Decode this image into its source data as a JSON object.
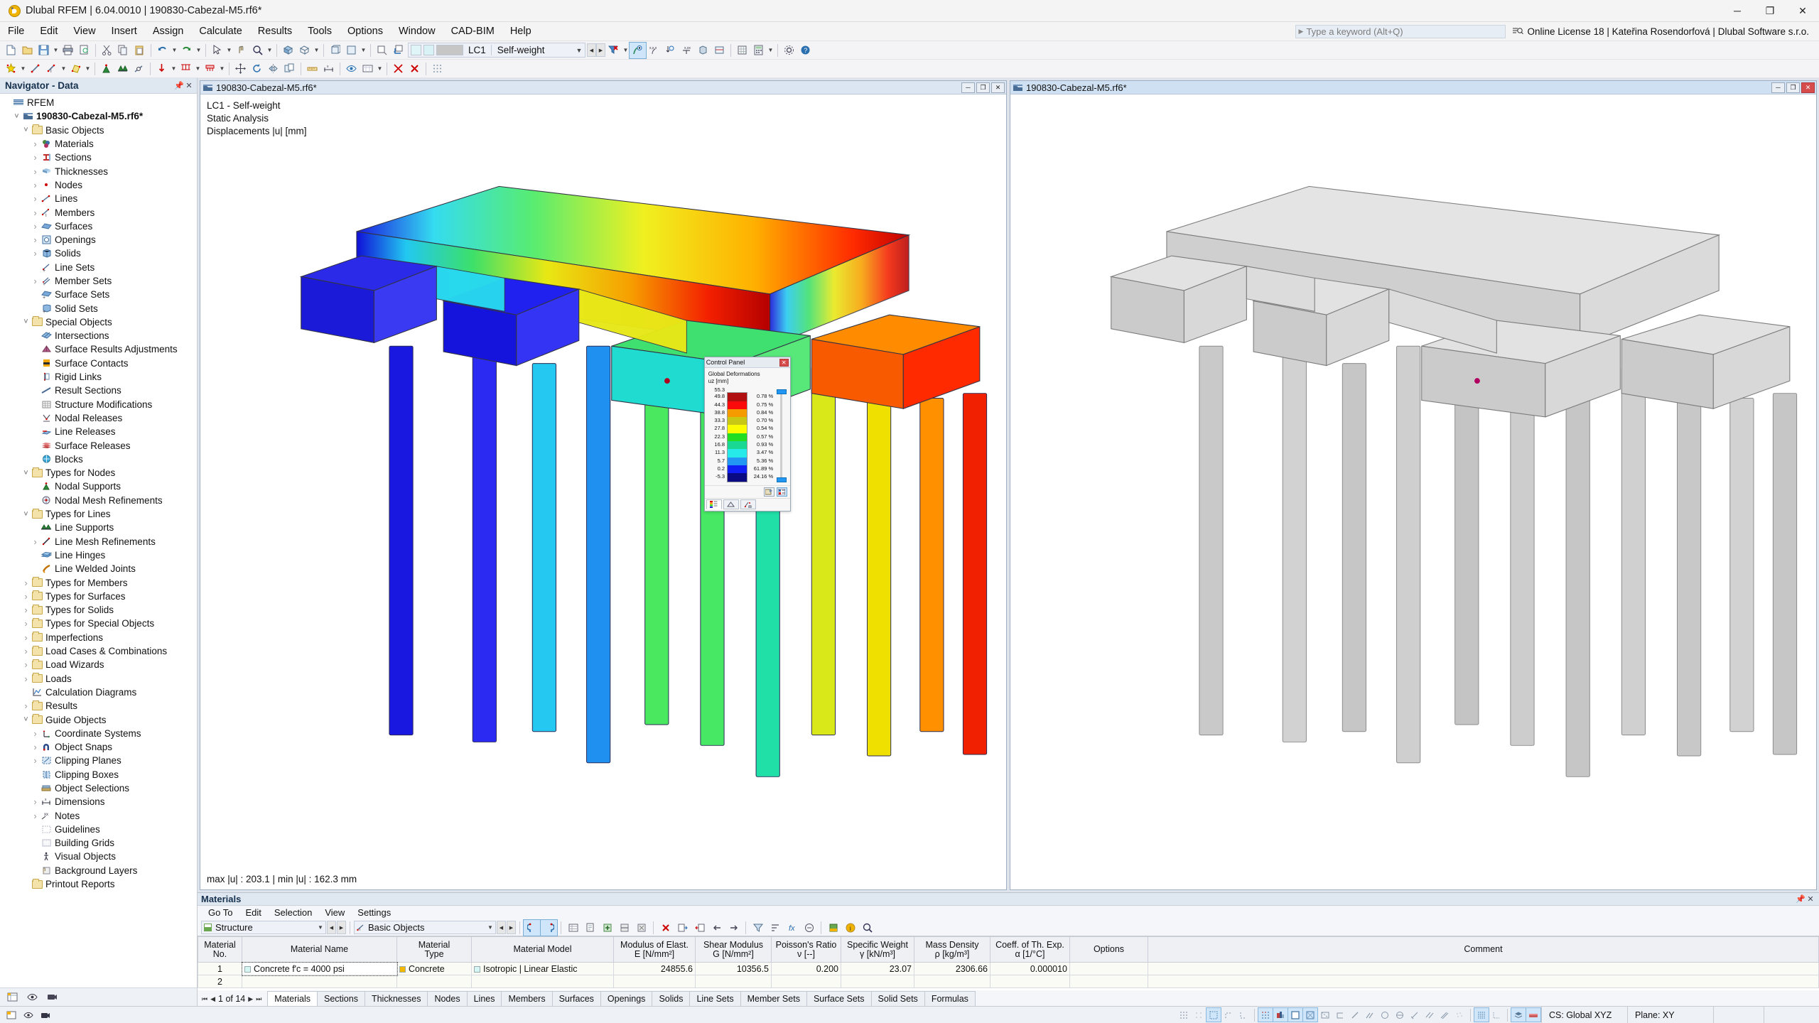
{
  "window": {
    "title": "Dlubal RFEM | 6.04.0010 | 190830-Cabezal-M5.rf6*",
    "app_icon": "dlubal-logo-icon",
    "minimize": "─",
    "maximize": "❐",
    "close": "✕"
  },
  "menubar": {
    "items": [
      {
        "label": "File"
      },
      {
        "label": "Edit"
      },
      {
        "label": "View"
      },
      {
        "label": "Insert"
      },
      {
        "label": "Assign"
      },
      {
        "label": "Calculate"
      },
      {
        "label": "Results"
      },
      {
        "label": "Tools"
      },
      {
        "label": "Options"
      },
      {
        "label": "Window"
      },
      {
        "label": "CAD-BIM"
      },
      {
        "label": "Help"
      }
    ],
    "keyword_placeholder": "Type a keyword (Alt+Q)",
    "license": "Online License 18 | Kateřina Rosendorfová | Dlubal Software s.r.o."
  },
  "toolbar": {
    "load_case_id": "LC1",
    "load_case_name": "Self-weight"
  },
  "navigator": {
    "title": "Navigator - Data",
    "root": "RFEM",
    "model": "190830-Cabezal-M5.rf6*",
    "items": [
      {
        "label": "RFEM",
        "indent": 0,
        "icon": "rfem-icon",
        "twisty": "",
        "bold": false
      },
      {
        "label": "190830-Cabezal-M5.rf6*",
        "indent": 1,
        "icon": "model-icon",
        "twisty": "open",
        "bold": true
      },
      {
        "label": "Basic Objects",
        "indent": 2,
        "icon": "folder",
        "twisty": "open",
        "bold": false
      },
      {
        "label": "Materials",
        "indent": 3,
        "icon": "materials-icon",
        "twisty": "closed"
      },
      {
        "label": "Sections",
        "indent": 3,
        "icon": "sections-icon",
        "twisty": "closed"
      },
      {
        "label": "Thicknesses",
        "indent": 3,
        "icon": "thicknesses-icon",
        "twisty": "closed"
      },
      {
        "label": "Nodes",
        "indent": 3,
        "icon": "nodes-icon",
        "twisty": "closed"
      },
      {
        "label": "Lines",
        "indent": 3,
        "icon": "lines-icon",
        "twisty": "closed"
      },
      {
        "label": "Members",
        "indent": 3,
        "icon": "members-icon",
        "twisty": "closed"
      },
      {
        "label": "Surfaces",
        "indent": 3,
        "icon": "surfaces-icon",
        "twisty": "closed"
      },
      {
        "label": "Openings",
        "indent": 3,
        "icon": "openings-icon",
        "twisty": "closed"
      },
      {
        "label": "Solids",
        "indent": 3,
        "icon": "solids-icon",
        "twisty": "closed"
      },
      {
        "label": "Line Sets",
        "indent": 3,
        "icon": "line-sets-icon",
        "twisty": ""
      },
      {
        "label": "Member Sets",
        "indent": 3,
        "icon": "member-sets-icon",
        "twisty": "closed"
      },
      {
        "label": "Surface Sets",
        "indent": 3,
        "icon": "surface-sets-icon",
        "twisty": ""
      },
      {
        "label": "Solid Sets",
        "indent": 3,
        "icon": "solid-sets-icon",
        "twisty": ""
      },
      {
        "label": "Special Objects",
        "indent": 2,
        "icon": "folder",
        "twisty": "open"
      },
      {
        "label": "Intersections",
        "indent": 3,
        "icon": "intersections-icon",
        "twisty": ""
      },
      {
        "label": "Surface Results Adjustments",
        "indent": 3,
        "icon": "surface-results-adjustments-icon",
        "twisty": ""
      },
      {
        "label": "Surface Contacts",
        "indent": 3,
        "icon": "surface-contacts-icon",
        "twisty": ""
      },
      {
        "label": "Rigid Links",
        "indent": 3,
        "icon": "rigid-links-icon",
        "twisty": ""
      },
      {
        "label": "Result Sections",
        "indent": 3,
        "icon": "result-sections-icon",
        "twisty": ""
      },
      {
        "label": "Structure Modifications",
        "indent": 3,
        "icon": "structure-modifications-icon",
        "twisty": ""
      },
      {
        "label": "Nodal Releases",
        "indent": 3,
        "icon": "nodal-releases-icon",
        "twisty": ""
      },
      {
        "label": "Line Releases",
        "indent": 3,
        "icon": "line-releases-icon",
        "twisty": ""
      },
      {
        "label": "Surface Releases",
        "indent": 3,
        "icon": "surface-releases-icon",
        "twisty": ""
      },
      {
        "label": "Blocks",
        "indent": 3,
        "icon": "blocks-icon",
        "twisty": ""
      },
      {
        "label": "Types for Nodes",
        "indent": 2,
        "icon": "folder",
        "twisty": "open"
      },
      {
        "label": "Nodal Supports",
        "indent": 3,
        "icon": "nodal-supports-icon",
        "twisty": ""
      },
      {
        "label": "Nodal Mesh Refinements",
        "indent": 3,
        "icon": "nodal-mesh-refinements-icon",
        "twisty": ""
      },
      {
        "label": "Types for Lines",
        "indent": 2,
        "icon": "folder",
        "twisty": "open"
      },
      {
        "label": "Line Supports",
        "indent": 3,
        "icon": "line-supports-icon",
        "twisty": ""
      },
      {
        "label": "Line Mesh Refinements",
        "indent": 3,
        "icon": "line-mesh-refinements-icon",
        "twisty": "closed"
      },
      {
        "label": "Line Hinges",
        "indent": 3,
        "icon": "line-hinges-icon",
        "twisty": ""
      },
      {
        "label": "Line Welded Joints",
        "indent": 3,
        "icon": "line-welded-joints-icon",
        "twisty": ""
      },
      {
        "label": "Types for Members",
        "indent": 2,
        "icon": "folder",
        "twisty": "closed"
      },
      {
        "label": "Types for Surfaces",
        "indent": 2,
        "icon": "folder",
        "twisty": "closed"
      },
      {
        "label": "Types for Solids",
        "indent": 2,
        "icon": "folder",
        "twisty": "closed"
      },
      {
        "label": "Types for Special Objects",
        "indent": 2,
        "icon": "folder",
        "twisty": "closed"
      },
      {
        "label": "Imperfections",
        "indent": 2,
        "icon": "folder",
        "twisty": "closed"
      },
      {
        "label": "Load Cases & Combinations",
        "indent": 2,
        "icon": "folder",
        "twisty": "closed"
      },
      {
        "label": "Load Wizards",
        "indent": 2,
        "icon": "folder",
        "twisty": "closed"
      },
      {
        "label": "Loads",
        "indent": 2,
        "icon": "folder",
        "twisty": "closed"
      },
      {
        "label": "Calculation Diagrams",
        "indent": 2,
        "icon": "calculation-diagrams-icon",
        "twisty": ""
      },
      {
        "label": "Results",
        "indent": 2,
        "icon": "folder",
        "twisty": "closed"
      },
      {
        "label": "Guide Objects",
        "indent": 2,
        "icon": "folder",
        "twisty": "open"
      },
      {
        "label": "Coordinate Systems",
        "indent": 3,
        "icon": "coordinate-systems-icon",
        "twisty": "closed"
      },
      {
        "label": "Object Snaps",
        "indent": 3,
        "icon": "object-snaps-icon",
        "twisty": "closed"
      },
      {
        "label": "Clipping Planes",
        "indent": 3,
        "icon": "clipping-planes-icon",
        "twisty": "closed"
      },
      {
        "label": "Clipping Boxes",
        "indent": 3,
        "icon": "clipping-boxes-icon",
        "twisty": ""
      },
      {
        "label": "Object Selections",
        "indent": 3,
        "icon": "object-selections-icon",
        "twisty": ""
      },
      {
        "label": "Dimensions",
        "indent": 3,
        "icon": "dimensions-icon",
        "twisty": "closed"
      },
      {
        "label": "Notes",
        "indent": 3,
        "icon": "notes-icon",
        "twisty": "closed"
      },
      {
        "label": "Guidelines",
        "indent": 3,
        "icon": "guidelines-icon",
        "twisty": ""
      },
      {
        "label": "Building Grids",
        "indent": 3,
        "icon": "building-grids-icon",
        "twisty": ""
      },
      {
        "label": "Visual Objects",
        "indent": 3,
        "icon": "visual-objects-icon",
        "twisty": ""
      },
      {
        "label": "Background Layers",
        "indent": 3,
        "icon": "background-layers-icon",
        "twisty": ""
      },
      {
        "label": "Printout Reports",
        "indent": 2,
        "icon": "folder",
        "twisty": ""
      }
    ]
  },
  "viewport_left": {
    "title": "190830-Cabezal-M5.rf6*",
    "line1": "LC1 - Self-weight",
    "line2": "Static Analysis",
    "line3": "Displacements |u| [mm]",
    "footer": "max |u| : 203.1 | min |u| : 162.3 mm",
    "min_label": "─",
    "max_label": "❐",
    "close_label": "✕"
  },
  "viewport_right": {
    "title": "190830-Cabezal-M5.rf6*",
    "min_label": "─",
    "max_label": "❐",
    "close_label": "✕"
  },
  "control_panel": {
    "title": "Control Panel",
    "close_label": "✕",
    "subtitle_line1": "Global Deformations",
    "subtitle_line2": "uᴢ [mm]",
    "scale_values": [
      "55.3",
      "49.8",
      "44.3",
      "38.8",
      "33.3",
      "27.8",
      "22.3",
      "16.8",
      "11.3",
      "5.7",
      "0.2",
      "-5.3"
    ],
    "bands": [
      {
        "color": "#b01010",
        "percent": "0.78 %"
      },
      {
        "color": "#fa0a0a",
        "percent": "0.75 %"
      },
      {
        "color": "#f59b00",
        "percent": "0.84 %"
      },
      {
        "color": "#c8c814",
        "percent": "0.70 %"
      },
      {
        "color": "#fcfc00",
        "percent": "0.54 %"
      },
      {
        "color": "#22dd22",
        "percent": "0.57 %"
      },
      {
        "color": "#18d894",
        "percent": "0.93 %"
      },
      {
        "color": "#26e9e9",
        "percent": "3.47 %"
      },
      {
        "color": "#2196f3",
        "percent": "5.36 %"
      },
      {
        "color": "#1020f5",
        "percent": "61.89 %"
      },
      {
        "color": "#0a0a82",
        "percent": "24.16 %"
      }
    ],
    "tabs": [
      "color-scale-tab",
      "factors-tab",
      "display-tab"
    ]
  },
  "table_panel": {
    "title": "Materials",
    "menu": [
      "Go To",
      "Edit",
      "Selection",
      "View",
      "Settings"
    ],
    "combo1": "Structure",
    "combo2": "Basic Objects",
    "columns": [
      {
        "l1": "Material",
        "l2": "No."
      },
      {
        "l1": "",
        "l2": "Material Name"
      },
      {
        "l1": "Material",
        "l2": "Type"
      },
      {
        "l1": "",
        "l2": "Material Model"
      },
      {
        "l1": "Modulus of Elast.",
        "l2": "E [N/mm²]"
      },
      {
        "l1": "Shear Modulus",
        "l2": "G [N/mm²]"
      },
      {
        "l1": "Poisson's Ratio",
        "l2": "ν [--]"
      },
      {
        "l1": "Specific Weight",
        "l2": "γ [kN/m³]"
      },
      {
        "l1": "Mass Density",
        "l2": "ρ [kg/m³]"
      },
      {
        "l1": "Coeff. of Th. Exp.",
        "l2": "α [1/°C]"
      },
      {
        "l1": "",
        "l2": "Options"
      },
      {
        "l1": "",
        "l2": "Comment"
      }
    ],
    "rows": [
      {
        "no": "1",
        "name": "Concrete f'c = 4000 psi",
        "name_color": "#d6f5f5",
        "type": "Concrete",
        "type_color": "#f5b800",
        "model": "Isotropic | Linear Elastic",
        "model_color": "#d6f5f5",
        "E": "24855.6",
        "G": "10356.5",
        "nu": "0.200",
        "gamma": "23.07",
        "rho": "2306.66",
        "alpha": "0.000010",
        "options": "",
        "comment": ""
      },
      {
        "no": "2",
        "name": "",
        "name_color": "",
        "type": "",
        "type_color": "",
        "model": "",
        "model_color": "",
        "E": "",
        "G": "",
        "nu": "",
        "gamma": "",
        "rho": "",
        "alpha": "",
        "options": "",
        "comment": ""
      }
    ],
    "pager": "1 of 14",
    "tabs": [
      "Materials",
      "Sections",
      "Thicknesses",
      "Nodes",
      "Lines",
      "Members",
      "Surfaces",
      "Openings",
      "Solids",
      "Line Sets",
      "Member Sets",
      "Surface Sets",
      "Solid Sets",
      "Formulas"
    ],
    "active_tab": "Materials"
  },
  "statusbar": {
    "cs": "CS: Global XYZ",
    "plane": "Plane: XY"
  },
  "chart_data": {
    "type": "heatmap",
    "title": "Displacements |u| [mm] - LC1 Self-weight",
    "legend_label": "Global Deformations uᴢ [mm]",
    "scale_values": [
      55.3,
      49.8,
      44.3,
      38.8,
      33.3,
      27.8,
      22.3,
      16.8,
      11.3,
      5.7,
      0.2,
      -5.3
    ],
    "band_percents": [
      0.78,
      0.75,
      0.84,
      0.7,
      0.54,
      0.57,
      0.93,
      3.47,
      5.36,
      61.89,
      24.16
    ],
    "max_u": 203.1,
    "min_u": 162.3,
    "units": "mm"
  }
}
